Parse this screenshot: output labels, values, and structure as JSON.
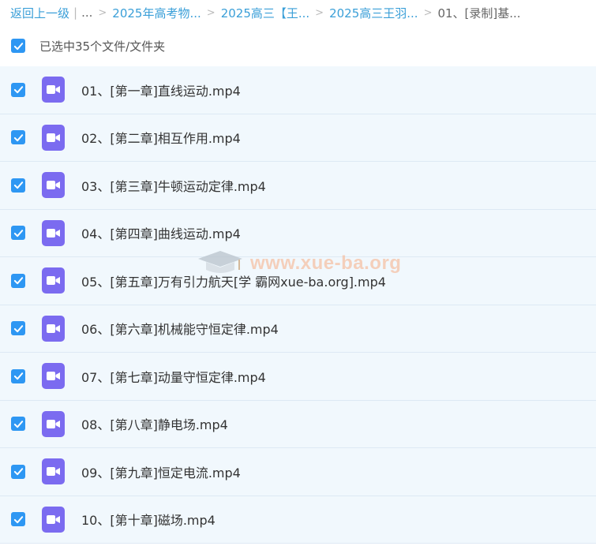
{
  "breadcrumb": {
    "back": "返回上一级",
    "ellipsis": "...",
    "crumbs": [
      "2025年高考物...",
      "2025高三【王...",
      "2025高三王羽..."
    ],
    "current": "01、[录制]基..."
  },
  "selection": {
    "label": "已选中35个文件/文件夹",
    "checked": true
  },
  "files": [
    {
      "name": "01、[第一章]直线运动.mp4",
      "checked": true,
      "icon": "video-file-icon"
    },
    {
      "name": "02、[第二章]相互作用.mp4",
      "checked": true,
      "icon": "video-file-icon"
    },
    {
      "name": "03、[第三章]牛顿运动定律.mp4",
      "checked": true,
      "icon": "video-file-icon"
    },
    {
      "name": "04、[第四章]曲线运动.mp4",
      "checked": true,
      "icon": "video-file-icon"
    },
    {
      "name": "05、[第五章]万有引力航天[学 霸网xue-ba.org].mp4",
      "checked": true,
      "icon": "video-file-icon"
    },
    {
      "name": "06、[第六章]机械能守恒定律.mp4",
      "checked": true,
      "icon": "video-file-icon"
    },
    {
      "name": "07、[第七章]动量守恒定律.mp4",
      "checked": true,
      "icon": "video-file-icon"
    },
    {
      "name": "08、[第八章]静电场.mp4",
      "checked": true,
      "icon": "video-file-icon"
    },
    {
      "name": "09、[第九章]恒定电流.mp4",
      "checked": true,
      "icon": "video-file-icon"
    },
    {
      "name": "10、[第十章]磁场.mp4",
      "checked": true,
      "icon": "video-file-icon"
    }
  ],
  "watermark": {
    "text": "www.xue-ba.org"
  },
  "colors": {
    "accent": "#3a9fd8",
    "checkbox": "#2e97f3",
    "video_icon": "#7b6bf0",
    "row_bg": "#f1f8fd"
  }
}
